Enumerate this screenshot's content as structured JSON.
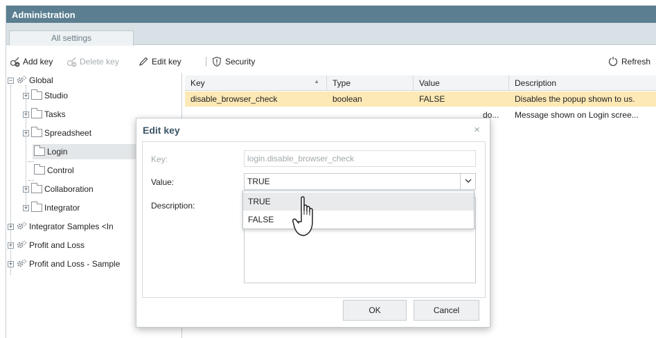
{
  "window": {
    "title": "Administration"
  },
  "tabs": [
    {
      "label": "All settings"
    }
  ],
  "toolbar": {
    "add_key": "Add key",
    "delete_key": "Delete key",
    "edit_key": "Edit key",
    "security": "Security",
    "refresh": "Refresh"
  },
  "tree": {
    "items": [
      {
        "label": "Global"
      },
      {
        "label": "Studio"
      },
      {
        "label": "Tasks"
      },
      {
        "label": "Spreadsheet"
      },
      {
        "label": "Login"
      },
      {
        "label": "Control"
      },
      {
        "label": "Collaboration"
      },
      {
        "label": "Integrator"
      },
      {
        "label": "Integrator Samples <In"
      },
      {
        "label": "Profit and Loss"
      },
      {
        "label": "Profit and Loss - Sample"
      }
    ]
  },
  "grid": {
    "columns": [
      "Key",
      "Type",
      "Value",
      "Description"
    ],
    "rows": [
      {
        "key": "disable_browser_check",
        "type": "boolean",
        "value": "FALSE",
        "description": "Disables the popup shown to us."
      },
      {
        "key": "",
        "type": "",
        "value": "do...",
        "description": "Message shown on Login scree..."
      }
    ]
  },
  "dialog": {
    "title": "Edit key",
    "close": "×",
    "key_label": "Key:",
    "key_value": "login.disable_browser_check",
    "value_label": "Value:",
    "value_selected": "TRUE",
    "description_label": "Description:",
    "options": [
      "TRUE",
      "FALSE"
    ],
    "ok": "OK",
    "cancel": "Cancel"
  },
  "colors": {
    "titlebar": "#5b7f91",
    "highlight_row": "#fde9b6",
    "tab_strip": "#d8e1e6"
  }
}
